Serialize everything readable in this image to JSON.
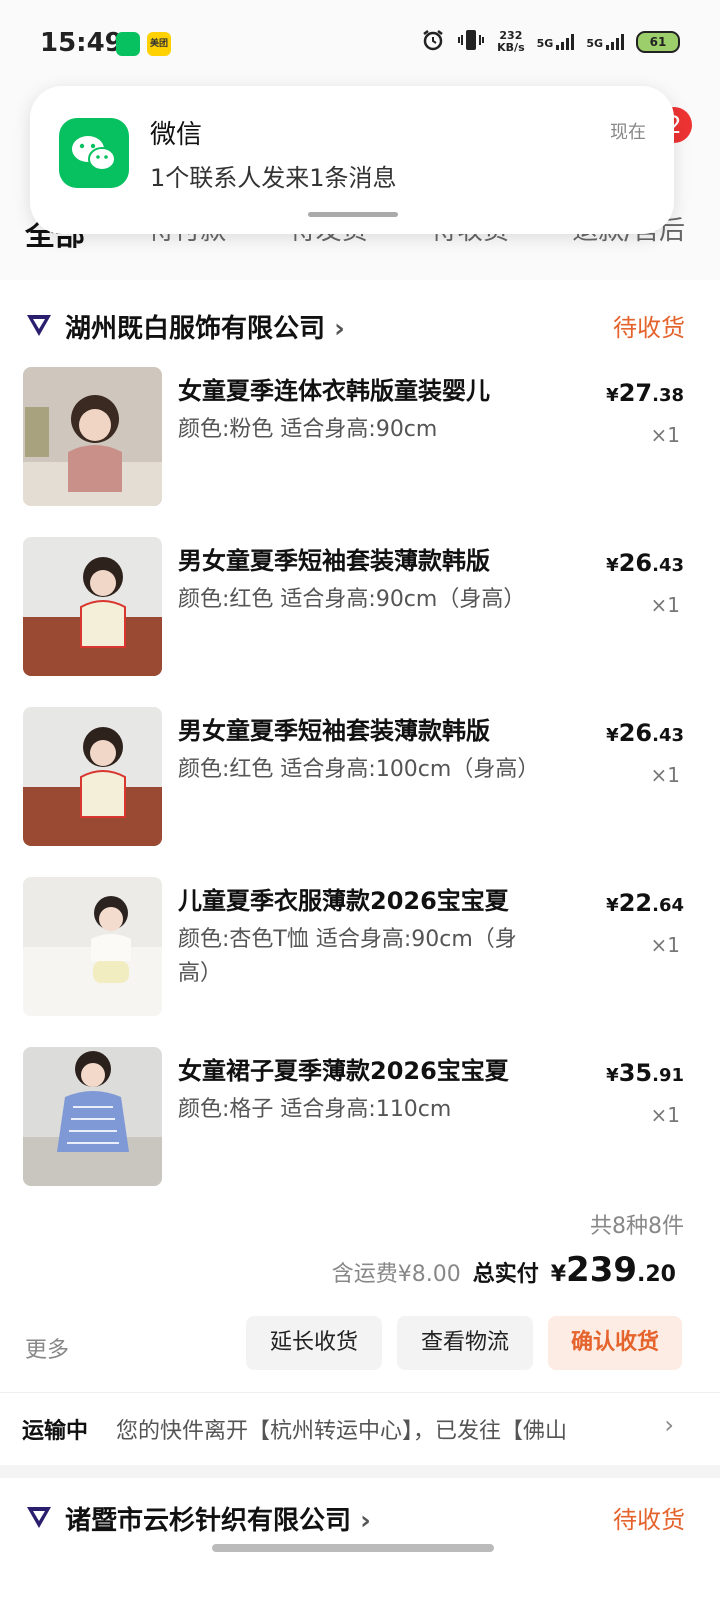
{
  "status_bar": {
    "time": "15:49",
    "net_speed": "232",
    "net_unit": "KB/s",
    "sim1": "5G",
    "sim2": "5G",
    "battery": "61"
  },
  "notification": {
    "app": "微信",
    "message": "1个联系人发来1条消息",
    "time": "现在",
    "badge_count": "2"
  },
  "tabs": [
    "全部",
    "待付款",
    "待发货",
    "待收货",
    "退款/售后"
  ],
  "order1": {
    "shop_name": "湖州既白服饰有限公司",
    "shop_arrow": "›",
    "status": "待收货",
    "items": [
      {
        "title": "女童夏季连体衣韩版童装婴儿",
        "spec": "颜色:粉色 适合身高:90cm",
        "cur": "¥",
        "int": "27",
        "dec": ".38",
        "qty": "×1"
      },
      {
        "title": "男女童夏季短袖套装薄款韩版",
        "spec": "颜色:红色 适合身高:90cm（身高）",
        "cur": "¥",
        "int": "26",
        "dec": ".43",
        "qty": "×1"
      },
      {
        "title": "男女童夏季短袖套装薄款韩版",
        "spec": "颜色:红色 适合身高:100cm（身高）",
        "cur": "¥",
        "int": "26",
        "dec": ".43",
        "qty": "×1"
      },
      {
        "title": "儿童夏季衣服薄款2026宝宝夏",
        "spec": "颜色:杏色T恤 适合身高:90cm（身高）",
        "cur": "¥",
        "int": "22",
        "dec": ".64",
        "qty": "×1"
      },
      {
        "title": "女童裙子夏季薄款2026宝宝夏",
        "spec": "颜色:格子 适合身高:110cm",
        "cur": "¥",
        "int": "35",
        "dec": ".91",
        "qty": "×1"
      }
    ],
    "count_text": "共8种8件",
    "shipping": "含运费¥8.00",
    "total_label": "总实付",
    "total_cur": "¥",
    "total_int": "239",
    "total_dec": ".20",
    "more": "更多",
    "buttons": {
      "extend": "延长收货",
      "logistics": "查看物流",
      "confirm": "确认收货"
    },
    "logistics": {
      "label": "运输中",
      "text": "您的快件离开【杭州转运中心】，已发往【佛山",
      "chevron": "›"
    }
  },
  "order2": {
    "shop_name": "诸暨市云杉针织有限公司",
    "shop_arrow": "›",
    "status": "待收货"
  },
  "colors": {
    "accent": "#e5632c",
    "wechat": "#07c160",
    "badge": "#e33333"
  }
}
